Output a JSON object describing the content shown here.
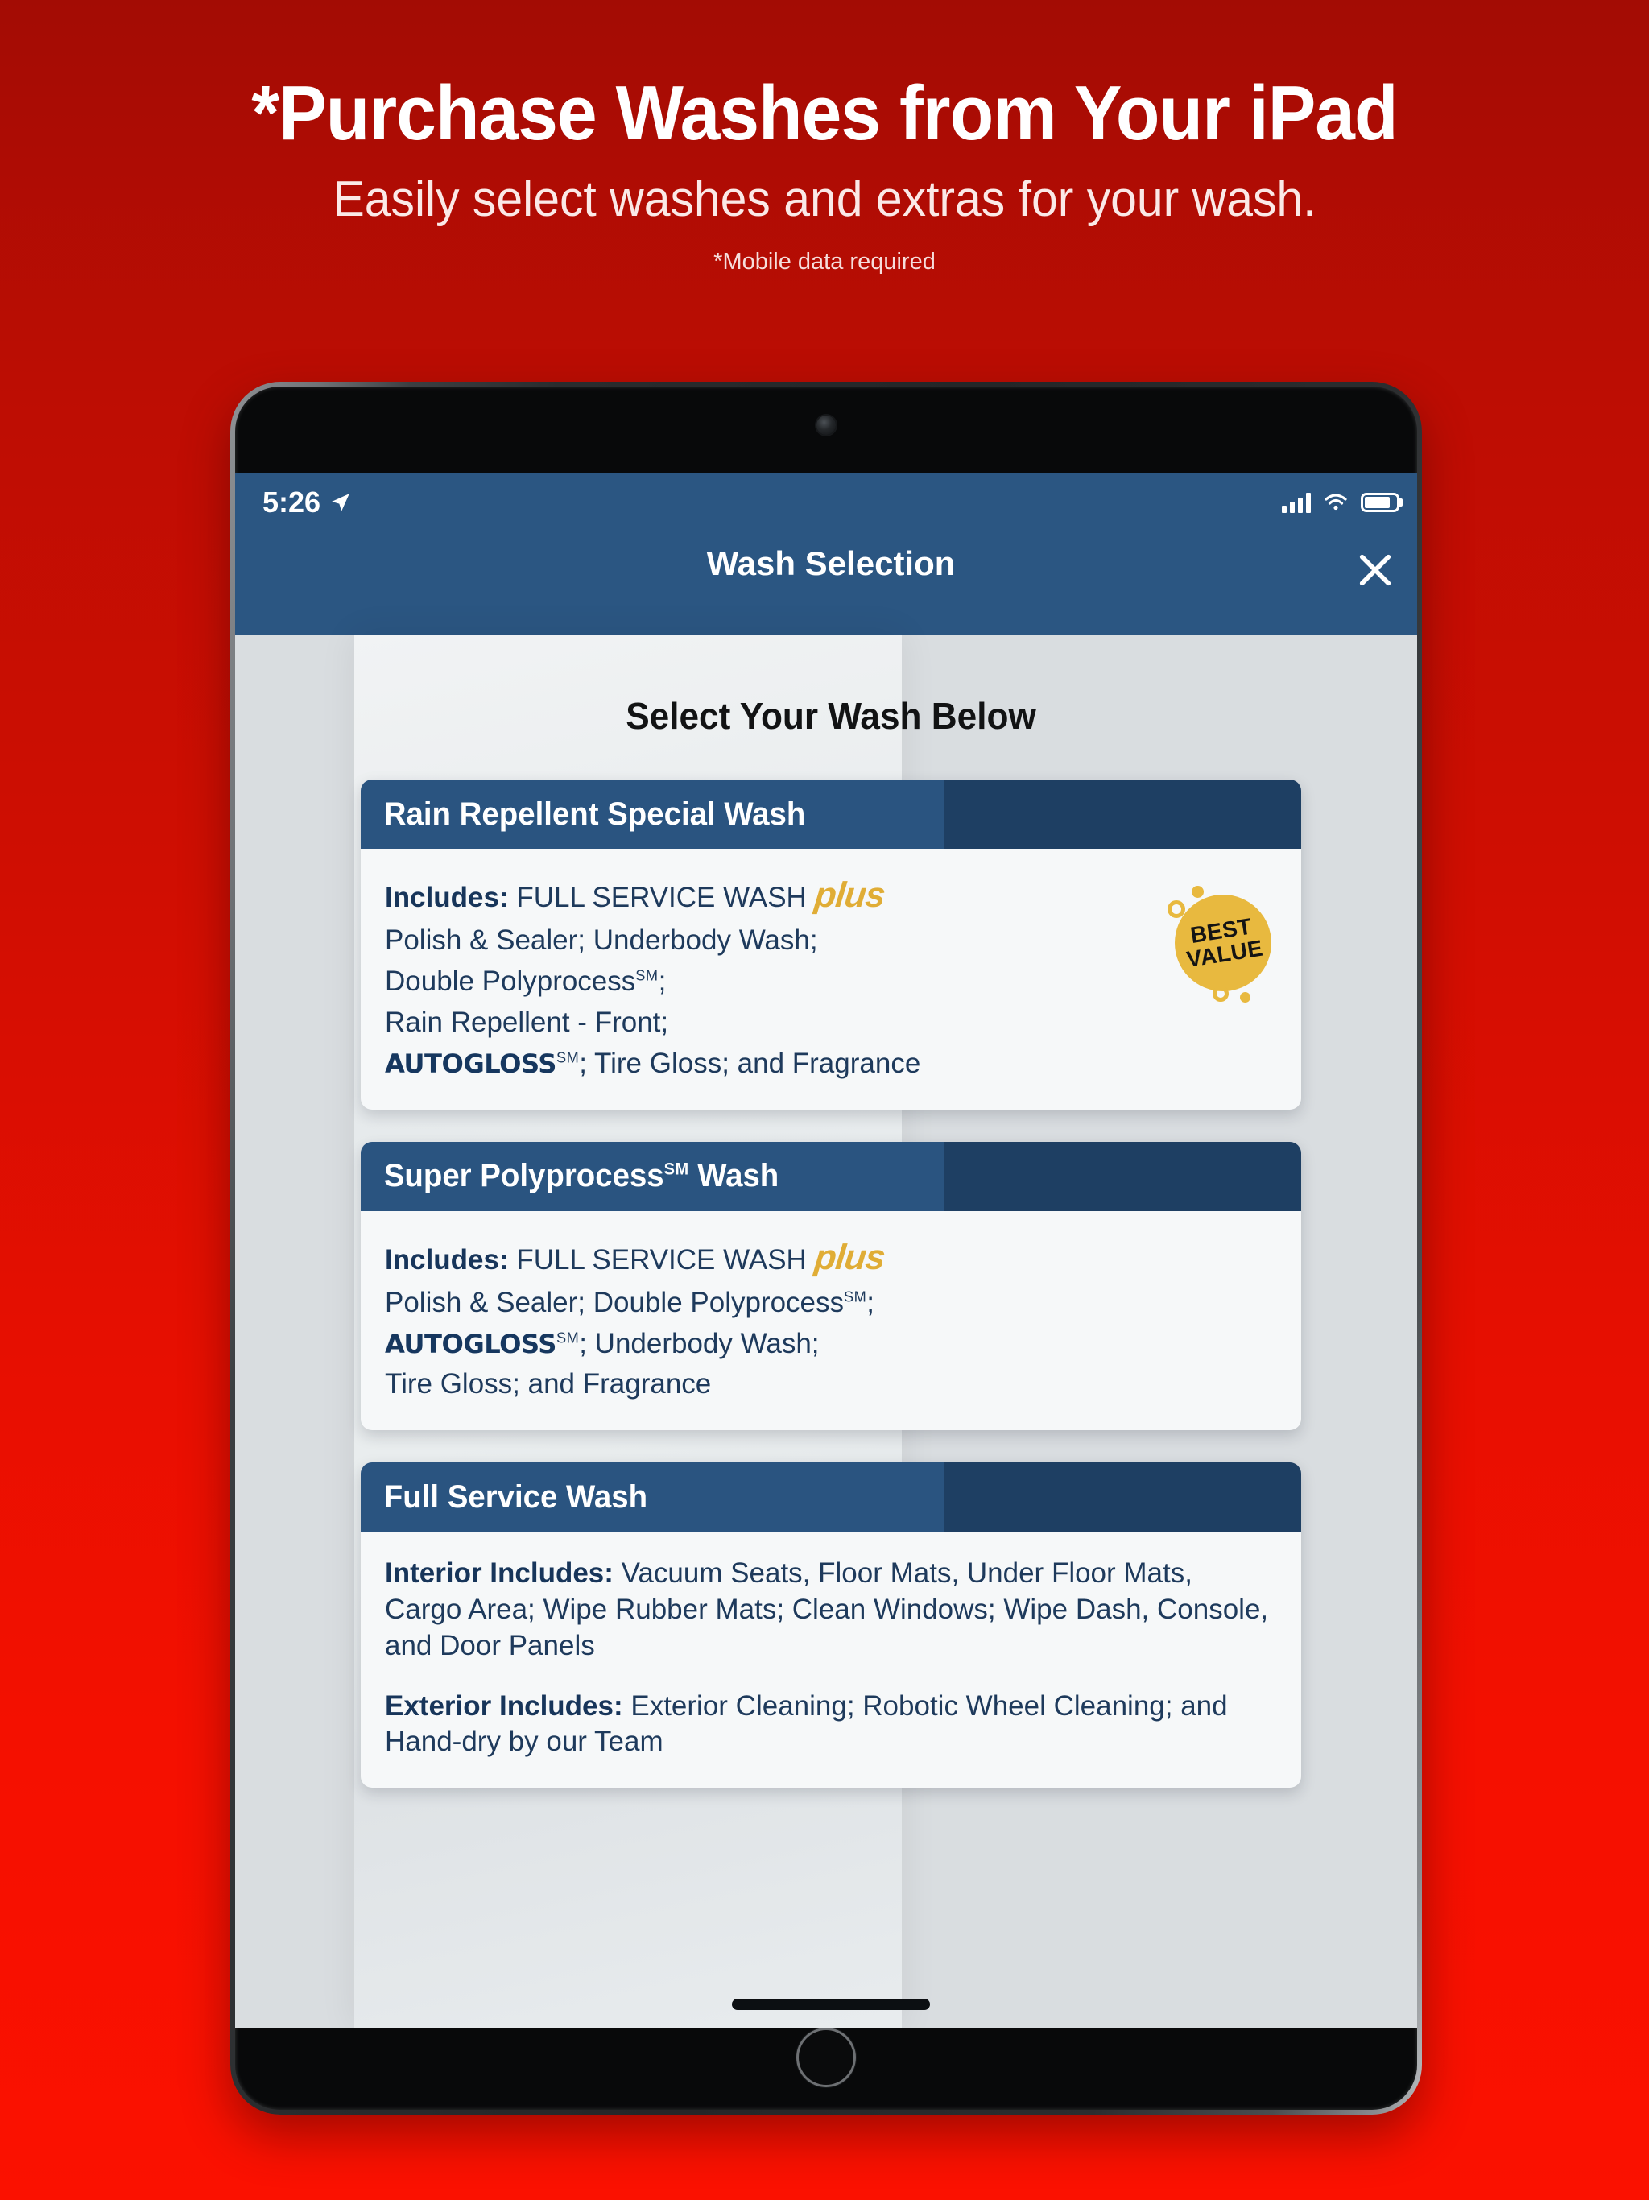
{
  "promo": {
    "title": "*Purchase Washes from Your iPad",
    "subtitle": "Easily select washes and extras for your wash.",
    "footnote": "*Mobile data required"
  },
  "device": {
    "name": "iPad"
  },
  "status_bar": {
    "time": "5:26",
    "location_icon": "location-arrow-icon",
    "cellular_icon": "cellular-signal-icon",
    "wifi_icon": "wifi-icon",
    "battery_icon": "battery-icon"
  },
  "navbar": {
    "title": "Wash Selection",
    "close_label": "close-icon"
  },
  "screen": {
    "heading": "Select Your Wash Below"
  },
  "badge": {
    "line1": "BEST",
    "line2": "VALUE"
  },
  "cards": [
    {
      "title_pre": "Rain Repellent Special Wash",
      "title_sm": "",
      "title_post": "",
      "lines": [
        {
          "label": "Includes:",
          "text": " FULL SERVICE WASH ",
          "plus": "plus"
        },
        {
          "text": "Polish & Sealer; Underbody Wash;"
        },
        {
          "text": "Double Polyprocess",
          "sm": "SM",
          "after": ";"
        },
        {
          "text": "Rain Repellent - Front;"
        },
        {
          "brand": "AUTOGLOSS",
          "sm": "SM",
          "after": "; Tire Gloss; and Fragrance"
        }
      ],
      "has_badge": true
    },
    {
      "title_pre": "Super Polyprocess",
      "title_sm": "SM",
      "title_post": " Wash",
      "lines": [
        {
          "label": "Includes:",
          "text": " FULL SERVICE WASH ",
          "plus": "plus"
        },
        {
          "text": "Polish & Sealer; Double Polyprocess",
          "sm": "SM",
          "after": ";"
        },
        {
          "brand": "AUTOGLOSS",
          "sm": "SM",
          "after": "; Underbody Wash;"
        },
        {
          "text": "Tire Gloss; and Fragrance"
        }
      ],
      "has_badge": false
    },
    {
      "title_pre": "Full Service Wash",
      "title_sm": "",
      "title_post": "",
      "lines": [
        {
          "label": "Interior Includes:",
          "text": " Vacuum Seats, Floor Mats, Under Floor Mats, Cargo Area; Wipe Rubber Mats; Clean Windows; Wipe Dash, Console, and Door Panels"
        },
        {
          "gap": true
        },
        {
          "label": "Exterior Includes:",
          "text": " Exterior Cleaning; Robotic Wheel Cleaning; and Hand-dry by our Team"
        }
      ],
      "has_badge": false
    }
  ],
  "colors": {
    "background_red_top": "#a30c04",
    "background_red_bottom": "#fb1100",
    "navbar_blue": "#2b5682",
    "card_header_blue": "#2a5480",
    "card_header_navy": "#1e3f63",
    "badge_gold": "#e8b93f",
    "plus_gold": "#e0ad36",
    "body_text_navy": "#1e3a5c",
    "screen_gray": "#d9dde0"
  }
}
